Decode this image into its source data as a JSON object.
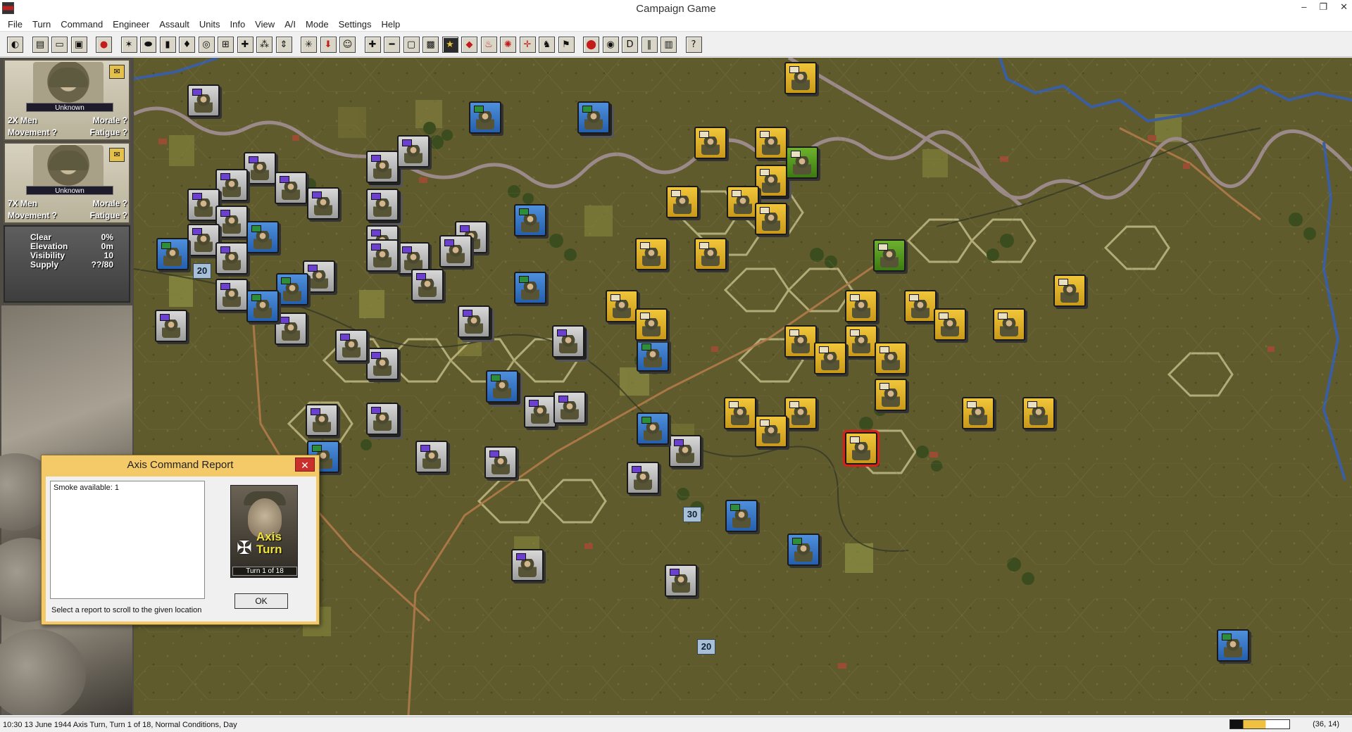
{
  "window": {
    "title": "Campaign Game"
  },
  "menu": [
    "File",
    "Turn",
    "Command",
    "Engineer",
    "Assault",
    "Units",
    "Info",
    "View",
    "A/I",
    "Mode",
    "Settings",
    "Help"
  ],
  "toolbar": {
    "last_label": "?"
  },
  "sidebar": {
    "units": [
      {
        "status": "Unknown",
        "men": "2X Men",
        "morale": "Morale ?",
        "movement": "Movement ?",
        "fatigue": "Fatigue ?"
      },
      {
        "status": "Unknown",
        "men": "7X Men",
        "morale": "Morale ?",
        "movement": "Movement ?",
        "fatigue": "Fatigue ?"
      }
    ],
    "terrain": [
      {
        "label": "Clear",
        "value": "0%"
      },
      {
        "label": "Elevation",
        "value": "0m"
      },
      {
        "label": "Visibility",
        "value": "10"
      },
      {
        "label": "Supply",
        "value": "??/80"
      }
    ]
  },
  "map": {
    "markers": [
      "20",
      "30",
      "20"
    ]
  },
  "dialog": {
    "title": "Axis Command Report",
    "close": "✕",
    "report_item": "Smoke available: 1",
    "hint": "Select a report to scroll to the given location",
    "side_label": "Axis Turn",
    "turn_label": "Turn 1 of 18",
    "ok": "OK"
  },
  "status": {
    "text": "10:30 13 June 1944 Axis Turn, Turn 1 of 18, Normal Conditions, Day",
    "coords": "(36, 14)"
  },
  "colors": {
    "axis": "#e0b42a",
    "allied": "#3a78c8",
    "neutral": "#b8b8b8",
    "map_base": "#5e5a2c"
  }
}
